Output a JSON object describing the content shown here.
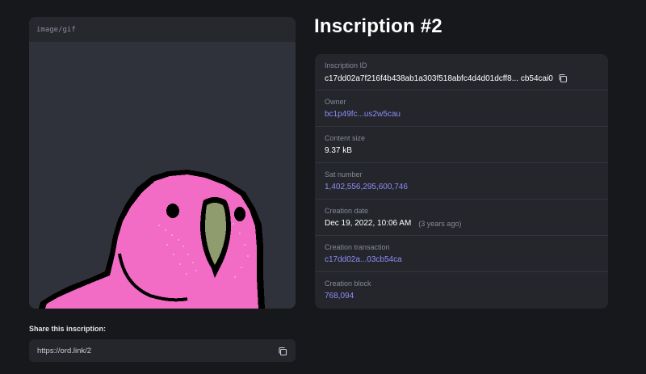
{
  "media": {
    "content_type": "image/gif",
    "image_description": "pink pixel-art parrot"
  },
  "share": {
    "label": "Share this inscription:",
    "url": "https://ord.link/2",
    "copy_icon": "copy-icon"
  },
  "page": {
    "title": "Inscription #2"
  },
  "details": {
    "inscription_id": {
      "label": "Inscription ID",
      "value": "c17dd02a7f216f4b438ab1a303f518abfc4d4d01dcff8... cb54cai0"
    },
    "owner": {
      "label": "Owner",
      "value": "bc1p49fc...us2w5cau"
    },
    "content_size": {
      "label": "Content size",
      "value": "9.37 kB"
    },
    "sat_number": {
      "label": "Sat number",
      "value": "1,402,556,295,600,746"
    },
    "creation_date": {
      "label": "Creation date",
      "value": "Dec 19, 2022, 10:06 AM",
      "relative": "(3 years ago)"
    },
    "creation_transaction": {
      "label": "Creation transaction",
      "value": "c17dd02a...03cb54ca"
    },
    "creation_block": {
      "label": "Creation block",
      "value": "768,094"
    }
  },
  "colors": {
    "background": "#17181c",
    "card": "#24262c",
    "link": "#8d8df5",
    "parrot": "#f26bc5",
    "beak": "#8f9c6e"
  }
}
